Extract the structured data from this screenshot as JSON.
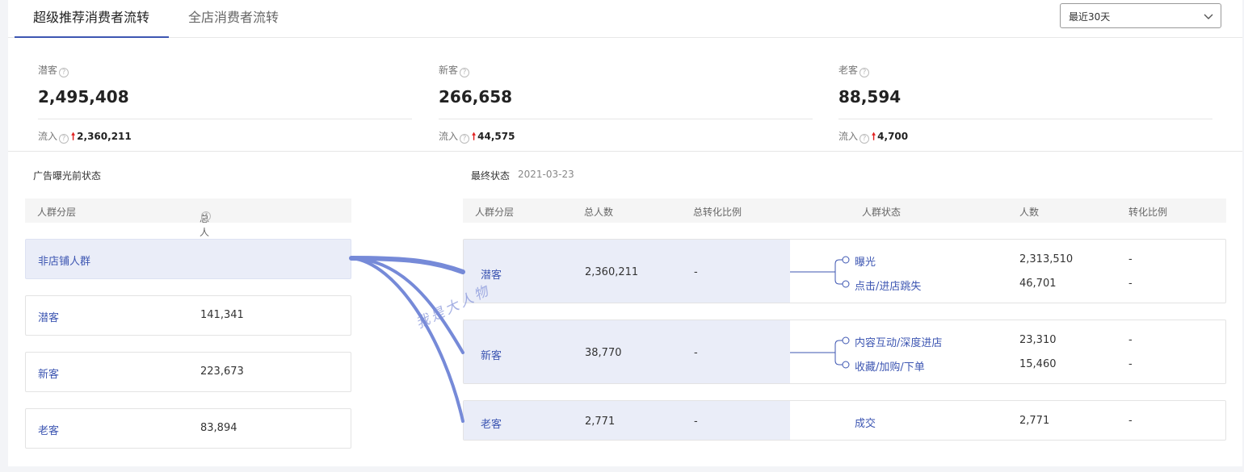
{
  "tabs": [
    {
      "label": "超级推荐消费者流转",
      "active": true
    },
    {
      "label": "全店消费者流转",
      "active": false
    }
  ],
  "date_select": {
    "value": "最近30天"
  },
  "stats": [
    {
      "label": "潜客",
      "value": "2,495,408",
      "inflow_label": "流入",
      "inflow_value": "2,360,211"
    },
    {
      "label": "新客",
      "value": "266,658",
      "inflow_label": "流入",
      "inflow_value": "44,575"
    },
    {
      "label": "老客",
      "value": "88,594",
      "inflow_label": "流入",
      "inflow_value": "4,700"
    }
  ],
  "before": {
    "title": "广告曝光前状态",
    "headers": [
      "人群分层",
      "总人数"
    ],
    "rows": [
      {
        "name": "非店铺人群",
        "count": ""
      },
      {
        "name": "潜客",
        "count": "141,341"
      },
      {
        "name": "新客",
        "count": "223,673"
      },
      {
        "name": "老客",
        "count": "83,894"
      }
    ]
  },
  "final": {
    "title": "最终状态",
    "date": "2021-03-23",
    "headers": [
      "人群分层",
      "总人数",
      "总转化比例",
      "人群状态",
      "人数",
      "转化比例"
    ],
    "rows": [
      {
        "name": "潜客",
        "total": "2,360,211",
        "rate": "-",
        "states": [
          {
            "label": "曝光",
            "count": "2,313,510",
            "rate": "-"
          },
          {
            "label": "点击/进店跳失",
            "count": "46,701",
            "rate": "-"
          }
        ]
      },
      {
        "name": "新客",
        "total": "38,770",
        "rate": "-",
        "states": [
          {
            "label": "内容互动/深度进店",
            "count": "23,310",
            "rate": "-"
          },
          {
            "label": "收藏/加购/下单",
            "count": "15,460",
            "rate": "-"
          }
        ]
      },
      {
        "name": "老客",
        "total": "2,771",
        "rate": "-",
        "states": [
          {
            "label": "成交",
            "count": "2,771",
            "rate": "-"
          }
        ]
      }
    ]
  },
  "watermark": "我是大人物",
  "colors": {
    "accent": "#3d56b2",
    "flow": "#6f84d6",
    "up_arrow": "#e02020",
    "row_highlight": "#eaedf8"
  },
  "icons": {
    "help": "question-circle-icon",
    "up": "arrow-up-icon",
    "dropdown": "chevron-down-icon"
  }
}
